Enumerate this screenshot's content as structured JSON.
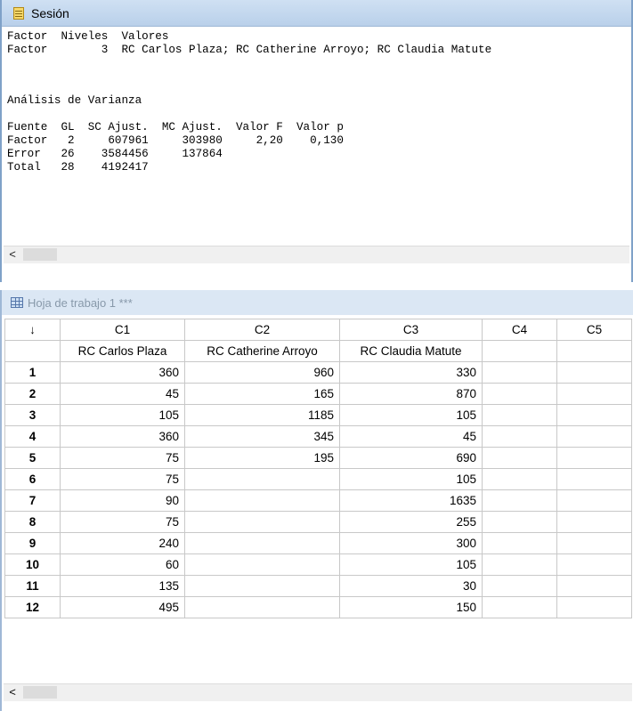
{
  "session": {
    "title": "Sesión",
    "lines": [
      "Factor  Niveles  Valores",
      "Factor        3  RC Carlos Plaza; RC Catherine Arroyo; RC Claudia Matute",
      "",
      "",
      "Análisis de Varianza",
      "",
      "Fuente  GL  SC Ajust.  MC Ajust.  Valor F  Valor p",
      "Factor   2     607961     303980     2,20    0,130",
      "Error   26    3584456     137864",
      "Total   28    4192417"
    ]
  },
  "worksheet": {
    "title": "Hoja de trabajo 1 ***",
    "corner": "↓",
    "column_ids": [
      "C1",
      "C2",
      "C3",
      "C4",
      "C5"
    ],
    "column_names": [
      "RC Carlos Plaza",
      "RC Catherine Arroyo",
      "RC Claudia Matute",
      "",
      ""
    ],
    "rows": [
      {
        "n": "1",
        "c1": "360",
        "c2": "960",
        "c3": "330"
      },
      {
        "n": "2",
        "c1": "45",
        "c2": "165",
        "c3": "870"
      },
      {
        "n": "3",
        "c1": "105",
        "c2": "1185",
        "c3": "105"
      },
      {
        "n": "4",
        "c1": "360",
        "c2": "345",
        "c3": "45"
      },
      {
        "n": "5",
        "c1": "75",
        "c2": "195",
        "c3": "690"
      },
      {
        "n": "6",
        "c1": "75",
        "c2": "",
        "c3": "105"
      },
      {
        "n": "7",
        "c1": "90",
        "c2": "",
        "c3": "1635"
      },
      {
        "n": "8",
        "c1": "75",
        "c2": "",
        "c3": "255"
      },
      {
        "n": "9",
        "c1": "240",
        "c2": "",
        "c3": "300"
      },
      {
        "n": "10",
        "c1": "60",
        "c2": "",
        "c3": "105"
      },
      {
        "n": "11",
        "c1": "135",
        "c2": "",
        "c3": "30"
      },
      {
        "n": "12",
        "c1": "495",
        "c2": "",
        "c3": "150"
      }
    ]
  },
  "scrollbar": {
    "left_arrow": "<"
  }
}
